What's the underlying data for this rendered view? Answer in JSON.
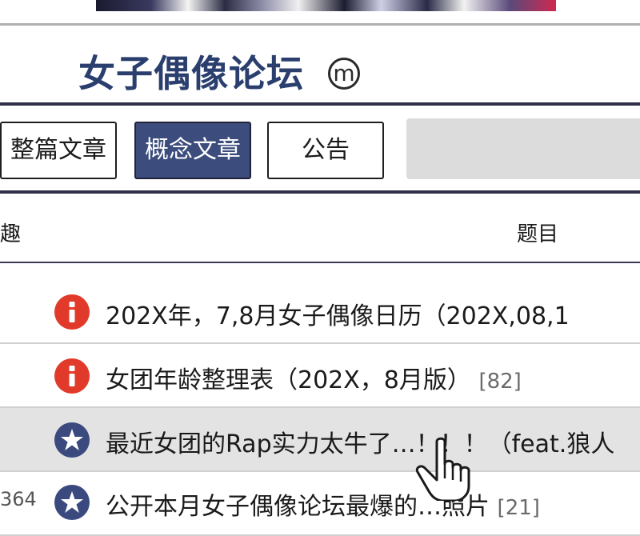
{
  "header": {
    "forum_title": "女子偶像论坛",
    "badge_letter": "m"
  },
  "tabs": [
    {
      "label": "整篇文章",
      "active": false
    },
    {
      "label": "概念文章",
      "active": true
    },
    {
      "label": "公告",
      "active": false
    }
  ],
  "table_header": {
    "col_left": "趣",
    "col_title": "题目"
  },
  "posts": [
    {
      "icon": "info-icon",
      "title": "202X年，7,8月女子偶像日历（202X,08,1",
      "count": ""
    },
    {
      "icon": "info-icon",
      "title": "女团年龄整理表（202X，8月版）",
      "count": "[82]"
    },
    {
      "icon": "star-icon",
      "title": "最近女团的Rap实力太牛了…！！！（feat.狼人",
      "count": ""
    },
    {
      "icon": "star-icon",
      "title": "公开本月女子偶像论坛最爆的…照片",
      "count": "[21]",
      "meta": "364"
    }
  ],
  "colors": {
    "title_blue": "#2b3f6f",
    "tab_active": "#3c4d7d",
    "notice_red": "#e23a2a",
    "star_blue": "#3a4a7e",
    "row_highlight": "#e3e3e3"
  }
}
